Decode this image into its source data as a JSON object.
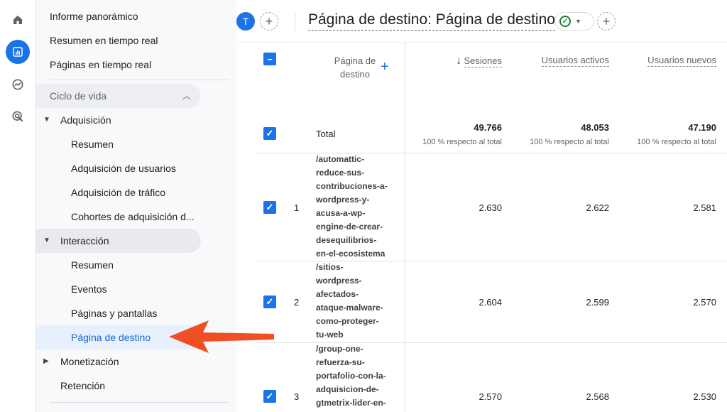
{
  "rail": {
    "icons": [
      "home-icon",
      "reports-icon",
      "explore-icon",
      "advertising-icon"
    ]
  },
  "nav": {
    "informe_panoramico": "Informe panorámico",
    "resumen_tiempo_real": "Resumen en tiempo real",
    "paginas_tiempo_real": "Páginas en tiempo real",
    "ciclo_de_vida": "Ciclo de vida",
    "adquisicion": "Adquisición",
    "adq_resumen": "Resumen",
    "adq_usuarios": "Adquisición de usuarios",
    "adq_trafico": "Adquisición de tráfico",
    "adq_cohortes": "Cohortes de adquisición d...",
    "interaccion": "Interacción",
    "int_resumen": "Resumen",
    "int_eventos": "Eventos",
    "int_paginas": "Páginas y pantallas",
    "int_destino": "Página de destino",
    "monetizacion": "Monetización",
    "retencion": "Retención"
  },
  "topbar": {
    "avatar_letter": "T",
    "add_label": "+",
    "title": "Página de destino: Página de destino"
  },
  "table": {
    "headers": {
      "dimension": "Página de destino",
      "sesiones": "Sesiones",
      "usuarios_activos": "Usuarios activos",
      "usuarios_nuevos": "Usuarios nuevos"
    },
    "sort_arrow": "↓",
    "add_dimension": "+",
    "total": {
      "label": "Total",
      "sesiones": "49.766",
      "usuarios_activos": "48.053",
      "usuarios_nuevos": "47.190",
      "pct": "100 % respecto al total"
    },
    "rows": [
      {
        "num": "1",
        "path_lines": [
          "/automattic-",
          "reduce-sus-",
          "contribuciones-a-",
          "wordpress-y-",
          "acusa-a-wp-",
          "engine-de-crear-",
          "desequilibrios-",
          "en-el-ecosistema"
        ],
        "sesiones": "2.630",
        "usuarios_activos": "2.622",
        "usuarios_nuevos": "2.581"
      },
      {
        "num": "2",
        "path_lines": [
          "/sitios-",
          "wordpress-",
          "afectados-",
          "ataque-malware-",
          "como-proteger-",
          "tu-web"
        ],
        "sesiones": "2.604",
        "usuarios_activos": "2.599",
        "usuarios_nuevos": "2.570"
      },
      {
        "num": "3",
        "path_lines": [
          "/group-one-",
          "refuerza-su-",
          "portafolio-con-la-",
          "adquisicion-de-",
          "gtmetrix-lider-en-"
        ],
        "sesiones": "2.570",
        "usuarios_activos": "2.568",
        "usuarios_nuevos": "2.530"
      }
    ]
  },
  "colors": {
    "accent": "#1a73e8",
    "arrow": "#f04e23",
    "selected_bg": "#e8f0fe"
  }
}
